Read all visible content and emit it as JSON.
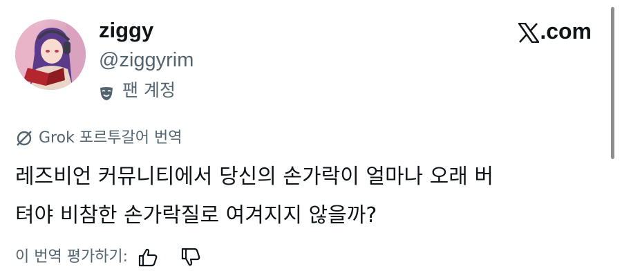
{
  "author": {
    "display_name": "ziggy",
    "handle": "@ziggyrim",
    "badge_label": "팬 계정",
    "badge_icon": "theater-mask-icon",
    "avatar_icon": "profile-avatar"
  },
  "brand": {
    "logo_icon": "x-logo-icon",
    "label": ".com"
  },
  "translation": {
    "icon": "grok-icon",
    "label": "Grok 포르투갈어 번역"
  },
  "tweet": {
    "lines": [
      "레즈비언 커뮤니티에서 당신의 손가락이 얼마나 오래 버",
      "텨야 비참한 손가락질로 여겨지지 않을까?"
    ]
  },
  "rating": {
    "label": "이 번역 평가하기:",
    "thumbs_up_icon": "thumbs-up-icon",
    "thumbs_down_icon": "thumbs-down-icon"
  },
  "colors": {
    "text_primary": "#0f1419",
    "text_secondary": "#536471",
    "background": "#ffffff"
  }
}
